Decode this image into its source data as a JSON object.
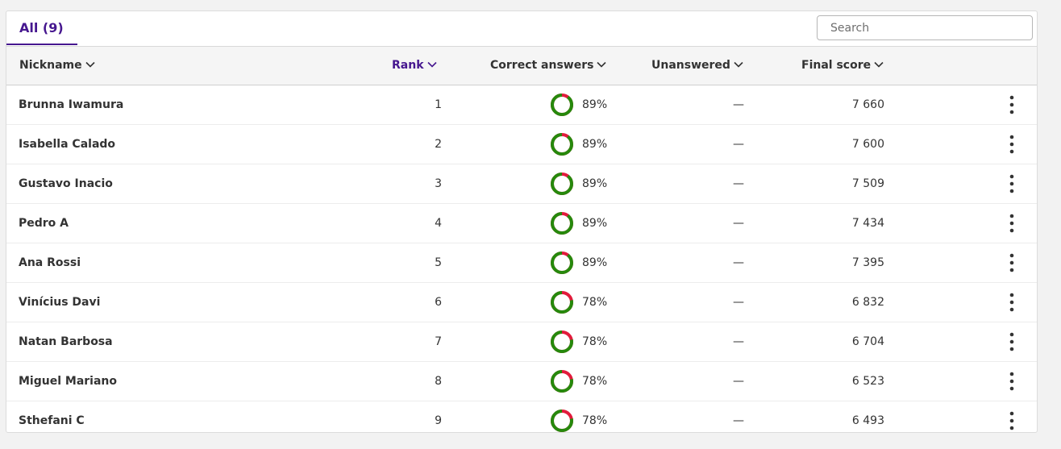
{
  "tab": {
    "label": "All (9)"
  },
  "search": {
    "placeholder": "Search"
  },
  "columns": {
    "nickname": "Nickname",
    "rank": "Rank",
    "correct": "Correct answers",
    "unanswered": "Unanswered",
    "final_score": "Final score"
  },
  "colors": {
    "accent": "#46178f",
    "correct": "#26890c",
    "incorrect": "#e21b3c"
  },
  "rows": [
    {
      "nickname": "Brunna Iwamura",
      "rank": "1",
      "correct_pct": 89,
      "correct_label": "89%",
      "unanswered": "—",
      "score": "7 660"
    },
    {
      "nickname": "Isabella Calado",
      "rank": "2",
      "correct_pct": 89,
      "correct_label": "89%",
      "unanswered": "—",
      "score": "7 600"
    },
    {
      "nickname": "Gustavo Inacio",
      "rank": "3",
      "correct_pct": 89,
      "correct_label": "89%",
      "unanswered": "—",
      "score": "7 509"
    },
    {
      "nickname": "Pedro A",
      "rank": "4",
      "correct_pct": 89,
      "correct_label": "89%",
      "unanswered": "—",
      "score": "7 434"
    },
    {
      "nickname": "Ana Rossi",
      "rank": "5",
      "correct_pct": 89,
      "correct_label": "89%",
      "unanswered": "—",
      "score": "7 395"
    },
    {
      "nickname": "Vinícius Davi",
      "rank": "6",
      "correct_pct": 78,
      "correct_label": "78%",
      "unanswered": "—",
      "score": "6 832"
    },
    {
      "nickname": "Natan Barbosa",
      "rank": "7",
      "correct_pct": 78,
      "correct_label": "78%",
      "unanswered": "—",
      "score": "6 704"
    },
    {
      "nickname": "Miguel Mariano",
      "rank": "8",
      "correct_pct": 78,
      "correct_label": "78%",
      "unanswered": "—",
      "score": "6 523"
    },
    {
      "nickname": "Sthefani C",
      "rank": "9",
      "correct_pct": 78,
      "correct_label": "78%",
      "unanswered": "—",
      "score": "6 493"
    }
  ]
}
